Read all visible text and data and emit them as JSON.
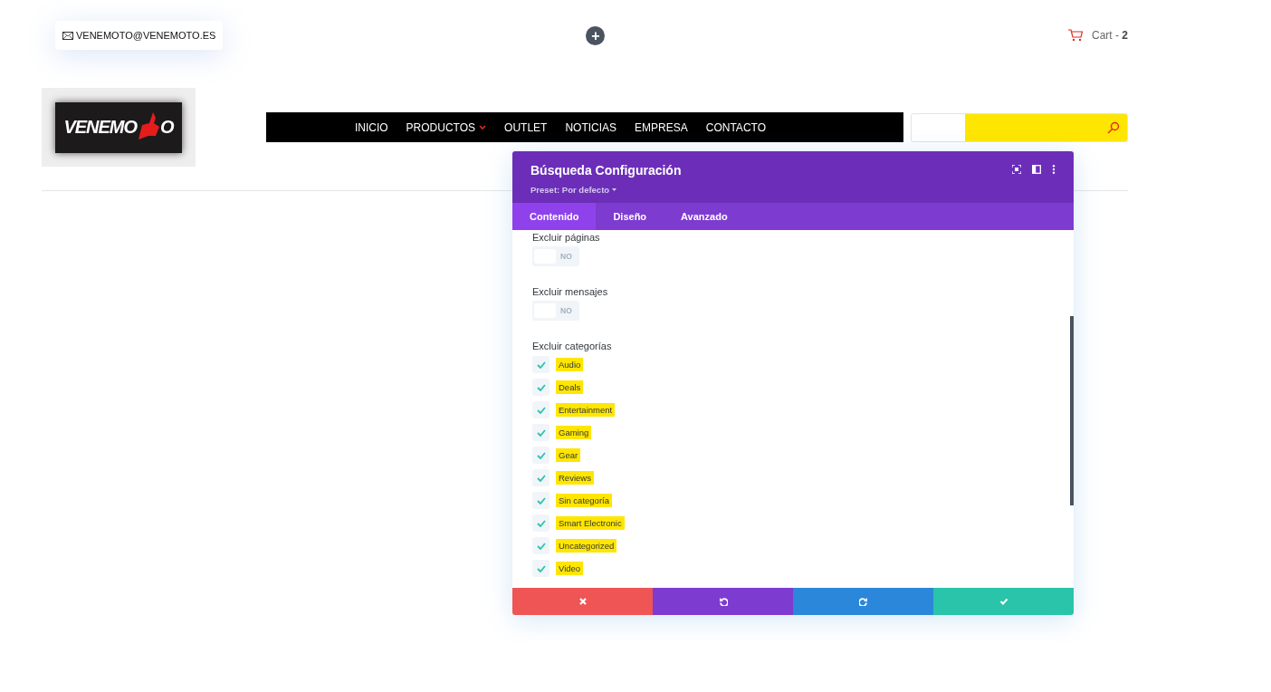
{
  "topbar": {
    "email": "VENEMOTO@VENEMOTO.ES",
    "add_button": "+",
    "cart": {
      "label": "Cart - ",
      "count": "2"
    }
  },
  "logo": {
    "text": "VENEMO",
    "tail": "O"
  },
  "nav": {
    "items": [
      {
        "label": "INICIO",
        "has_dropdown": false
      },
      {
        "label": "PRODUCTOS",
        "has_dropdown": true
      },
      {
        "label": "OUTLET",
        "has_dropdown": false
      },
      {
        "label": "NOTICIAS",
        "has_dropdown": false
      },
      {
        "label": "EMPRESA",
        "has_dropdown": false
      },
      {
        "label": "CONTACTO",
        "has_dropdown": false
      }
    ]
  },
  "search": {
    "highlighted": true
  },
  "modal": {
    "title": "Búsqueda Configuración",
    "preset": "Preset: Por defecto",
    "tabs": [
      {
        "label": "Contenido",
        "selected": true
      },
      {
        "label": "Diseño",
        "selected": false
      },
      {
        "label": "Avanzado",
        "selected": false
      }
    ],
    "toggles": [
      {
        "label": "Excluir páginas",
        "on": false,
        "state_text": "NO"
      },
      {
        "label": "Excluir mensajes",
        "on": false,
        "state_text": "NO"
      }
    ],
    "categories_label": "Excluir categorías",
    "categories": [
      {
        "label": "Audio",
        "checked": true,
        "highlighted": true
      },
      {
        "label": "Deals",
        "checked": true,
        "highlighted": true
      },
      {
        "label": "Entertainment",
        "checked": true,
        "highlighted": true
      },
      {
        "label": "Gaming",
        "checked": true,
        "highlighted": true
      },
      {
        "label": "Gear",
        "checked": true,
        "highlighted": true
      },
      {
        "label": "Reviews",
        "checked": true,
        "highlighted": true
      },
      {
        "label": "Sin categoría",
        "checked": true,
        "highlighted": true
      },
      {
        "label": "Smart Electronic",
        "checked": true,
        "highlighted": true
      },
      {
        "label": "Uncategorized",
        "checked": true,
        "highlighted": true
      },
      {
        "label": "Video",
        "checked": true,
        "highlighted": true
      }
    ],
    "footer": [
      {
        "kind": "cancel"
      },
      {
        "kind": "undo"
      },
      {
        "kind": "redo"
      },
      {
        "kind": "save"
      }
    ]
  }
}
